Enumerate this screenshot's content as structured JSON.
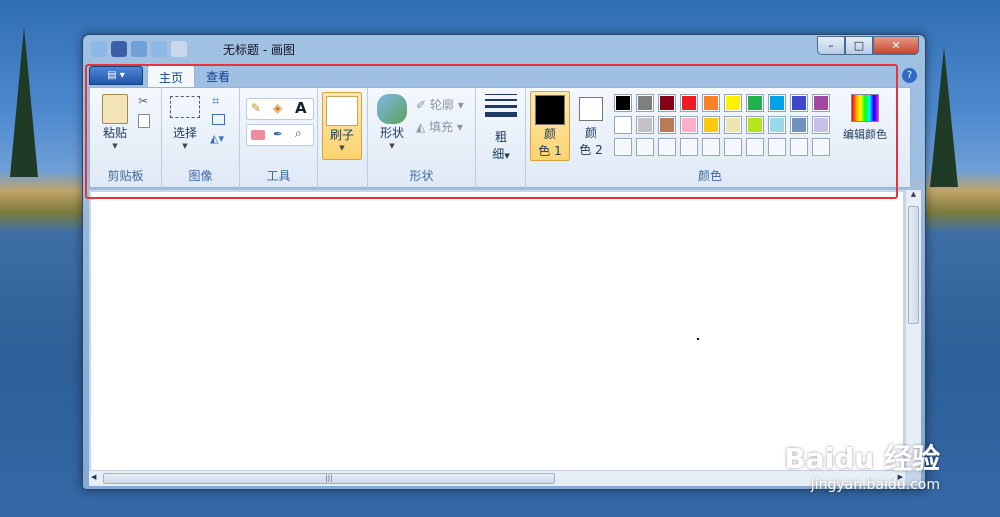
{
  "window": {
    "title": "无标题 - 画图",
    "help": "?"
  },
  "tabs": [
    {
      "label": "主页"
    },
    {
      "label": "查看"
    }
  ],
  "file_menu": {
    "icon": "file-menu-icon"
  },
  "controls": {
    "minimize": "–",
    "maximize": "□",
    "close": "✕"
  },
  "groups": {
    "clipboard": {
      "label": "剪贴板",
      "paste": "粘贴"
    },
    "image": {
      "label": "图像",
      "select": "选择"
    },
    "tools": {
      "label": "工具"
    },
    "brushes": {
      "label": "刷子"
    },
    "shapes": {
      "label": "形状",
      "shapes_btn": "形状",
      "outline": "轮廓",
      "fill": "填充"
    },
    "size": {
      "label_line1": "粗",
      "label_line2": "细"
    },
    "colors": {
      "label": "颜色",
      "color1_l1": "颜",
      "color1_l2": "色 1",
      "color2_l1": "颜",
      "color2_l2": "色 2",
      "edit_colors": "编辑颜色",
      "row1": [
        "#000000",
        "#7f7f7f",
        "#880015",
        "#ed1c24",
        "#ff7f27",
        "#fff200",
        "#22b14c",
        "#00a2e8",
        "#3f48cc",
        "#a349a4"
      ],
      "row2": [
        "#ffffff",
        "#c3c3c3",
        "#b97a57",
        "#ffaec9",
        "#ffc90e",
        "#efe4b0",
        "#b5e61d",
        "#99d9ea",
        "#7092be",
        "#c8bfe7"
      ],
      "row3": [
        "#f4f7fb",
        "#f4f7fb",
        "#f4f7fb",
        "#f4f7fb",
        "#f4f7fb",
        "#f4f7fb",
        "#f4f7fb",
        "#f4f7fb",
        "#f4f7fb",
        "#f4f7fb"
      ]
    }
  },
  "watermark": {
    "brand": "Bai",
    "brand2": "du 经验",
    "url": "jingyan.baidu.com"
  }
}
